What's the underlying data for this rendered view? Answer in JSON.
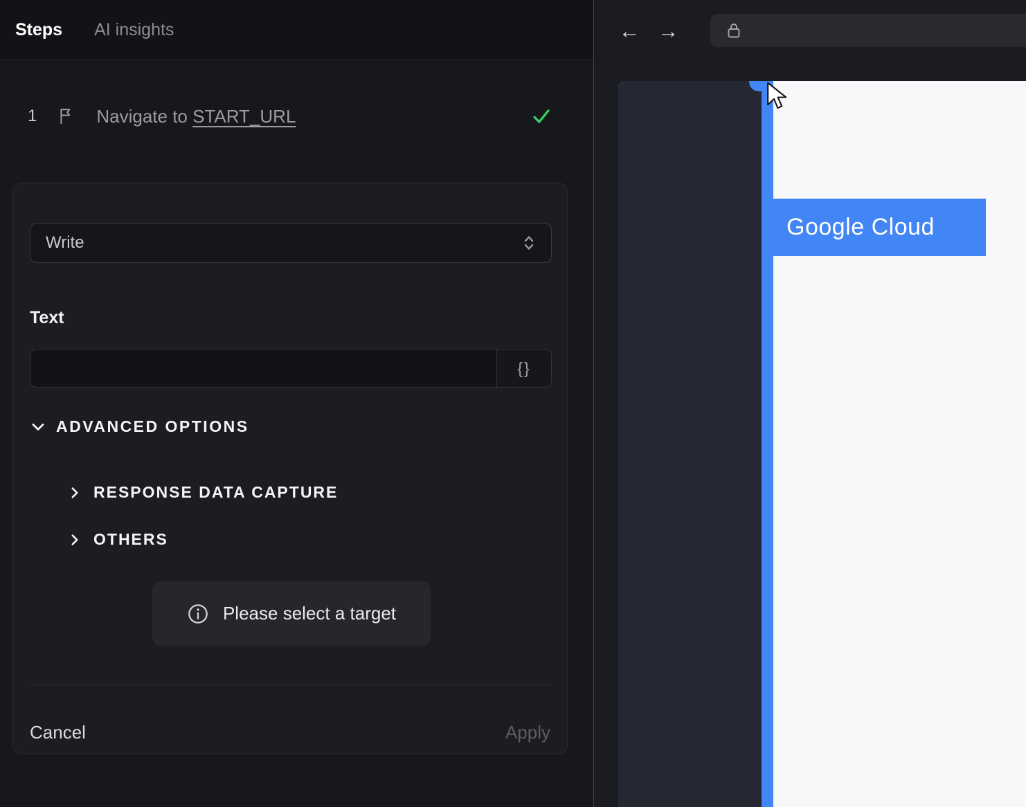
{
  "sidebar": {
    "tabs": [
      {
        "label": "Steps"
      },
      {
        "label": "AI insights"
      }
    ],
    "step": {
      "index": "1",
      "title": "Navigate to ",
      "link": "START_URL"
    },
    "form": {
      "action_value": "Write",
      "text_label": "Text",
      "text_value": "",
      "variable_button_label": "{}",
      "advanced_label": "ADVANCED OPTIONS",
      "sections": [
        {
          "label": "RESPONSE DATA CAPTURE"
        },
        {
          "label": "OTHERS"
        }
      ],
      "notice": "Please select a target",
      "cancel_label": "Cancel",
      "apply_label": "Apply"
    }
  },
  "browser": {
    "nav": {
      "back": "←",
      "forward": "→"
    },
    "page": {
      "highlight_label": "Google Cloud"
    }
  },
  "colors": {
    "accent_blue": "#4285f4",
    "success_green": "#3ad164",
    "panel_bg": "#17181c",
    "card_bg": "#1c1d23"
  }
}
